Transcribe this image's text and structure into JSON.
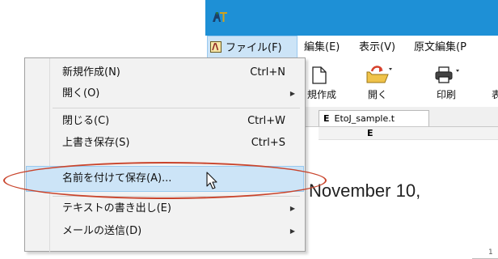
{
  "menubar": {
    "items": [
      "ファイル(F)",
      "編集(E)",
      "表示(V)",
      "原文編集(P"
    ]
  },
  "toolbar": {
    "new_label": "規作成",
    "open_label": "開く",
    "print_label": "印刷",
    "partial_label": "表"
  },
  "document": {
    "tab_letter": "E",
    "tab_name": "EtoJ_sample.t",
    "column_header": "E",
    "text": "November 10,",
    "line_number": "1"
  },
  "file_menu": {
    "items": [
      {
        "label": "新規作成(N)",
        "shortcut": "Ctrl+N",
        "submenu": false
      },
      {
        "label": "開く(O)",
        "shortcut": "",
        "submenu": true
      },
      {
        "label": "閉じる(C)",
        "shortcut": "Ctrl+W",
        "submenu": false
      },
      {
        "label": "上書き保存(S)",
        "shortcut": "Ctrl+S",
        "submenu": false
      },
      {
        "label": "名前を付けて保存(A)...",
        "shortcut": "",
        "submenu": false,
        "highlighted": true
      },
      {
        "label": "テキストの書き出し(E)",
        "shortcut": "",
        "submenu": true
      },
      {
        "label": "メールの送信(D)",
        "shortcut": "",
        "submenu": true
      }
    ]
  },
  "icons": [
    "app-logo-icon",
    "file-menu-icon",
    "new-document-icon",
    "open-folder-icon",
    "print-icon",
    "submenu-arrow-icon",
    "mouse-cursor-icon"
  ],
  "colors": {
    "titlebar": "#1e90d6",
    "menu_highlight": "#cce4f7",
    "annotation_oval": "#c9442c"
  }
}
